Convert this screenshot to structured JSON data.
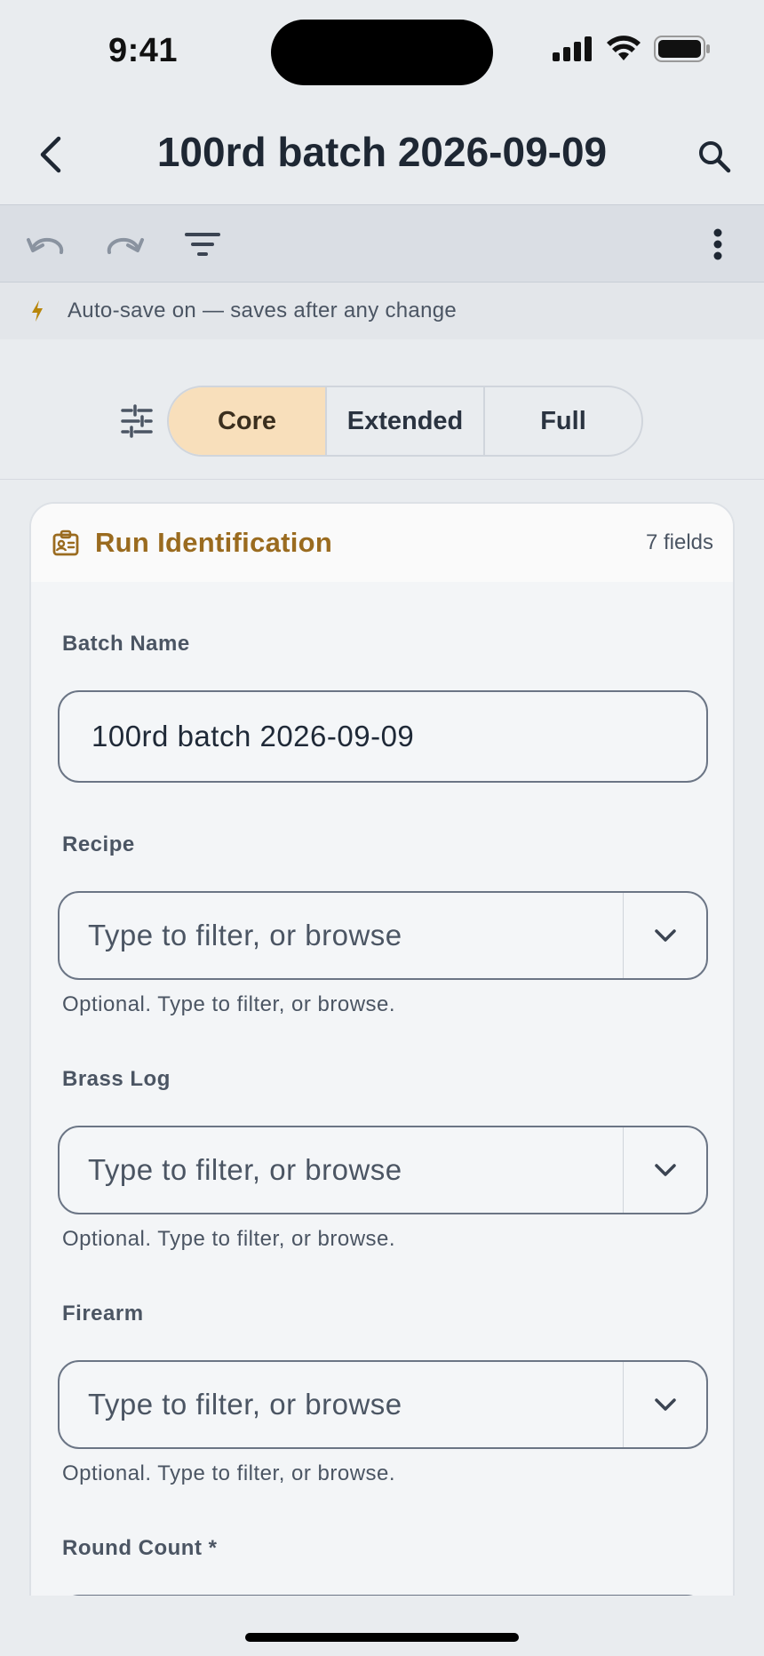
{
  "status_bar": {
    "time": "9:41"
  },
  "header": {
    "title": "100rd batch 2026-09-09"
  },
  "autosave": {
    "text": "Auto-save on — saves after any change"
  },
  "segment": {
    "options": [
      "Core",
      "Extended",
      "Full"
    ],
    "selected": "Core"
  },
  "card": {
    "title": "Run Identification",
    "count": "7 fields",
    "fields": [
      {
        "label": "Batch Name",
        "value": "100rd batch 2026-09-09"
      },
      {
        "label": "Recipe",
        "placeholder": "Type to filter, or browse",
        "helper": "Optional. Type to filter, or browse."
      },
      {
        "label": "Brass Log",
        "placeholder": "Type to filter, or browse",
        "helper": "Optional. Type to filter, or browse."
      },
      {
        "label": "Firearm",
        "placeholder": "Type to filter, or browse",
        "helper": "Optional. Type to filter, or browse."
      },
      {
        "label": "Round Count *"
      }
    ]
  },
  "colors": {
    "accent": "#9a6b1f",
    "segment_active": "#f8dfbb",
    "bolt": "#b8860b"
  },
  "icons": [
    "back-arrow-icon",
    "search-icon",
    "undo-icon",
    "redo-icon",
    "filter-icon",
    "more-vertical-icon",
    "bolt-icon",
    "tune-icon",
    "id-badge-icon",
    "chevron-down-icon"
  ]
}
